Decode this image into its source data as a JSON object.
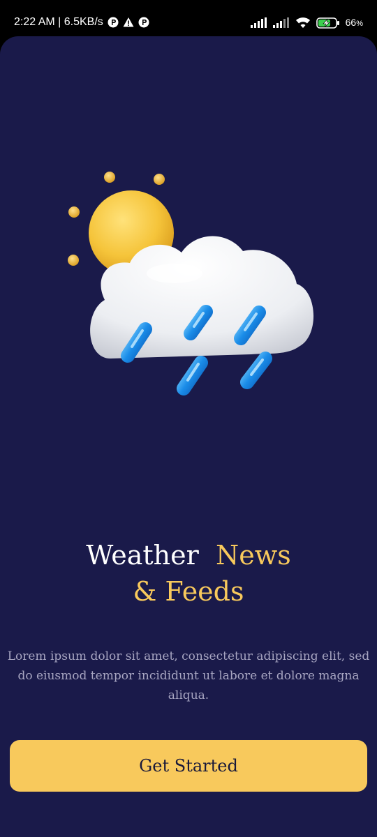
{
  "status_bar": {
    "time_speed": "2:22 AM | 6.5KB/s",
    "battery_percent": "66",
    "battery_unit": "%",
    "icons": [
      "notification-p-icon",
      "warning-icon",
      "notification-p-icon",
      "signal-icon",
      "signal-icon",
      "wifi-icon",
      "battery-charging-icon"
    ]
  },
  "hero": {
    "icon": "sun-cloud-rain-icon"
  },
  "title": {
    "part1": "Weather",
    "part2": "News",
    "part3": "& Feeds"
  },
  "description": "Lorem ipsum dolor sit amet, consectetur adipiscing elit, sed do eiusmod tempor incididunt ut labore et dolore magna aliqua.",
  "cta": {
    "label": "Get Started"
  },
  "colors": {
    "background": "#1a1a4a",
    "accent": "#f8c95c",
    "text": "#ffffff",
    "muted_text": "#a8a6c2"
  }
}
